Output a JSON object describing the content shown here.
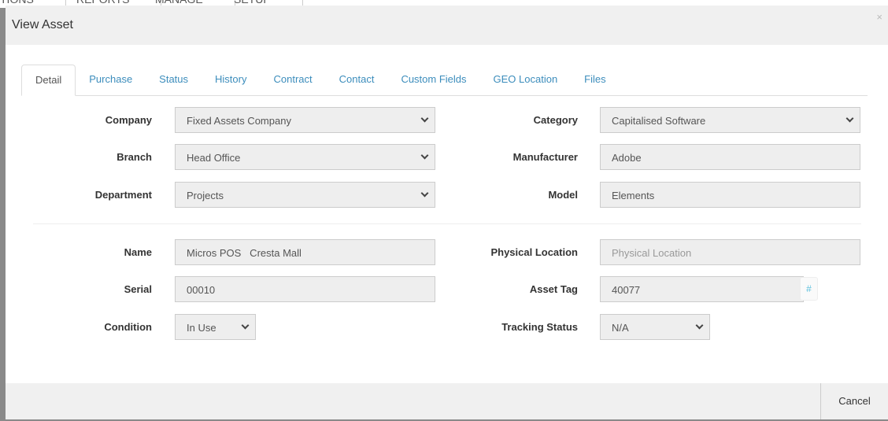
{
  "background_nav": [
    "TIONS",
    "REPORTS",
    "MANAGE",
    "SETUP"
  ],
  "modal": {
    "title": "View Asset",
    "close": "×"
  },
  "tabs": [
    "Detail",
    "Purchase",
    "Status",
    "History",
    "Contract",
    "Contact",
    "Custom Fields",
    "GEO Location",
    "Files"
  ],
  "active_tab": "Detail",
  "fields": {
    "company": {
      "label": "Company",
      "value": "Fixed Assets Company"
    },
    "branch": {
      "label": "Branch",
      "value": "Head Office"
    },
    "department": {
      "label": "Department",
      "value": "Projects"
    },
    "category": {
      "label": "Category",
      "value": "Capitalised Software"
    },
    "manufacturer": {
      "label": "Manufacturer",
      "value": "Adobe"
    },
    "model": {
      "label": "Model",
      "value": "Elements"
    },
    "name": {
      "label": "Name",
      "value": "Micros POS   Cresta Mall"
    },
    "serial": {
      "label": "Serial",
      "value": "00010"
    },
    "condition": {
      "label": "Condition",
      "value": "In Use"
    },
    "physical_location": {
      "label": "Physical Location",
      "placeholder": "Physical Location"
    },
    "asset_tag": {
      "label": "Asset Tag",
      "value": "40077",
      "button": "#"
    },
    "tracking_status": {
      "label": "Tracking Status",
      "value": "N/A"
    }
  },
  "footer": {
    "cancel": "Cancel"
  },
  "colors": {
    "link": "#3c8dbc",
    "header_bg": "#f0f0f0",
    "input_bg": "#eeeeee"
  }
}
